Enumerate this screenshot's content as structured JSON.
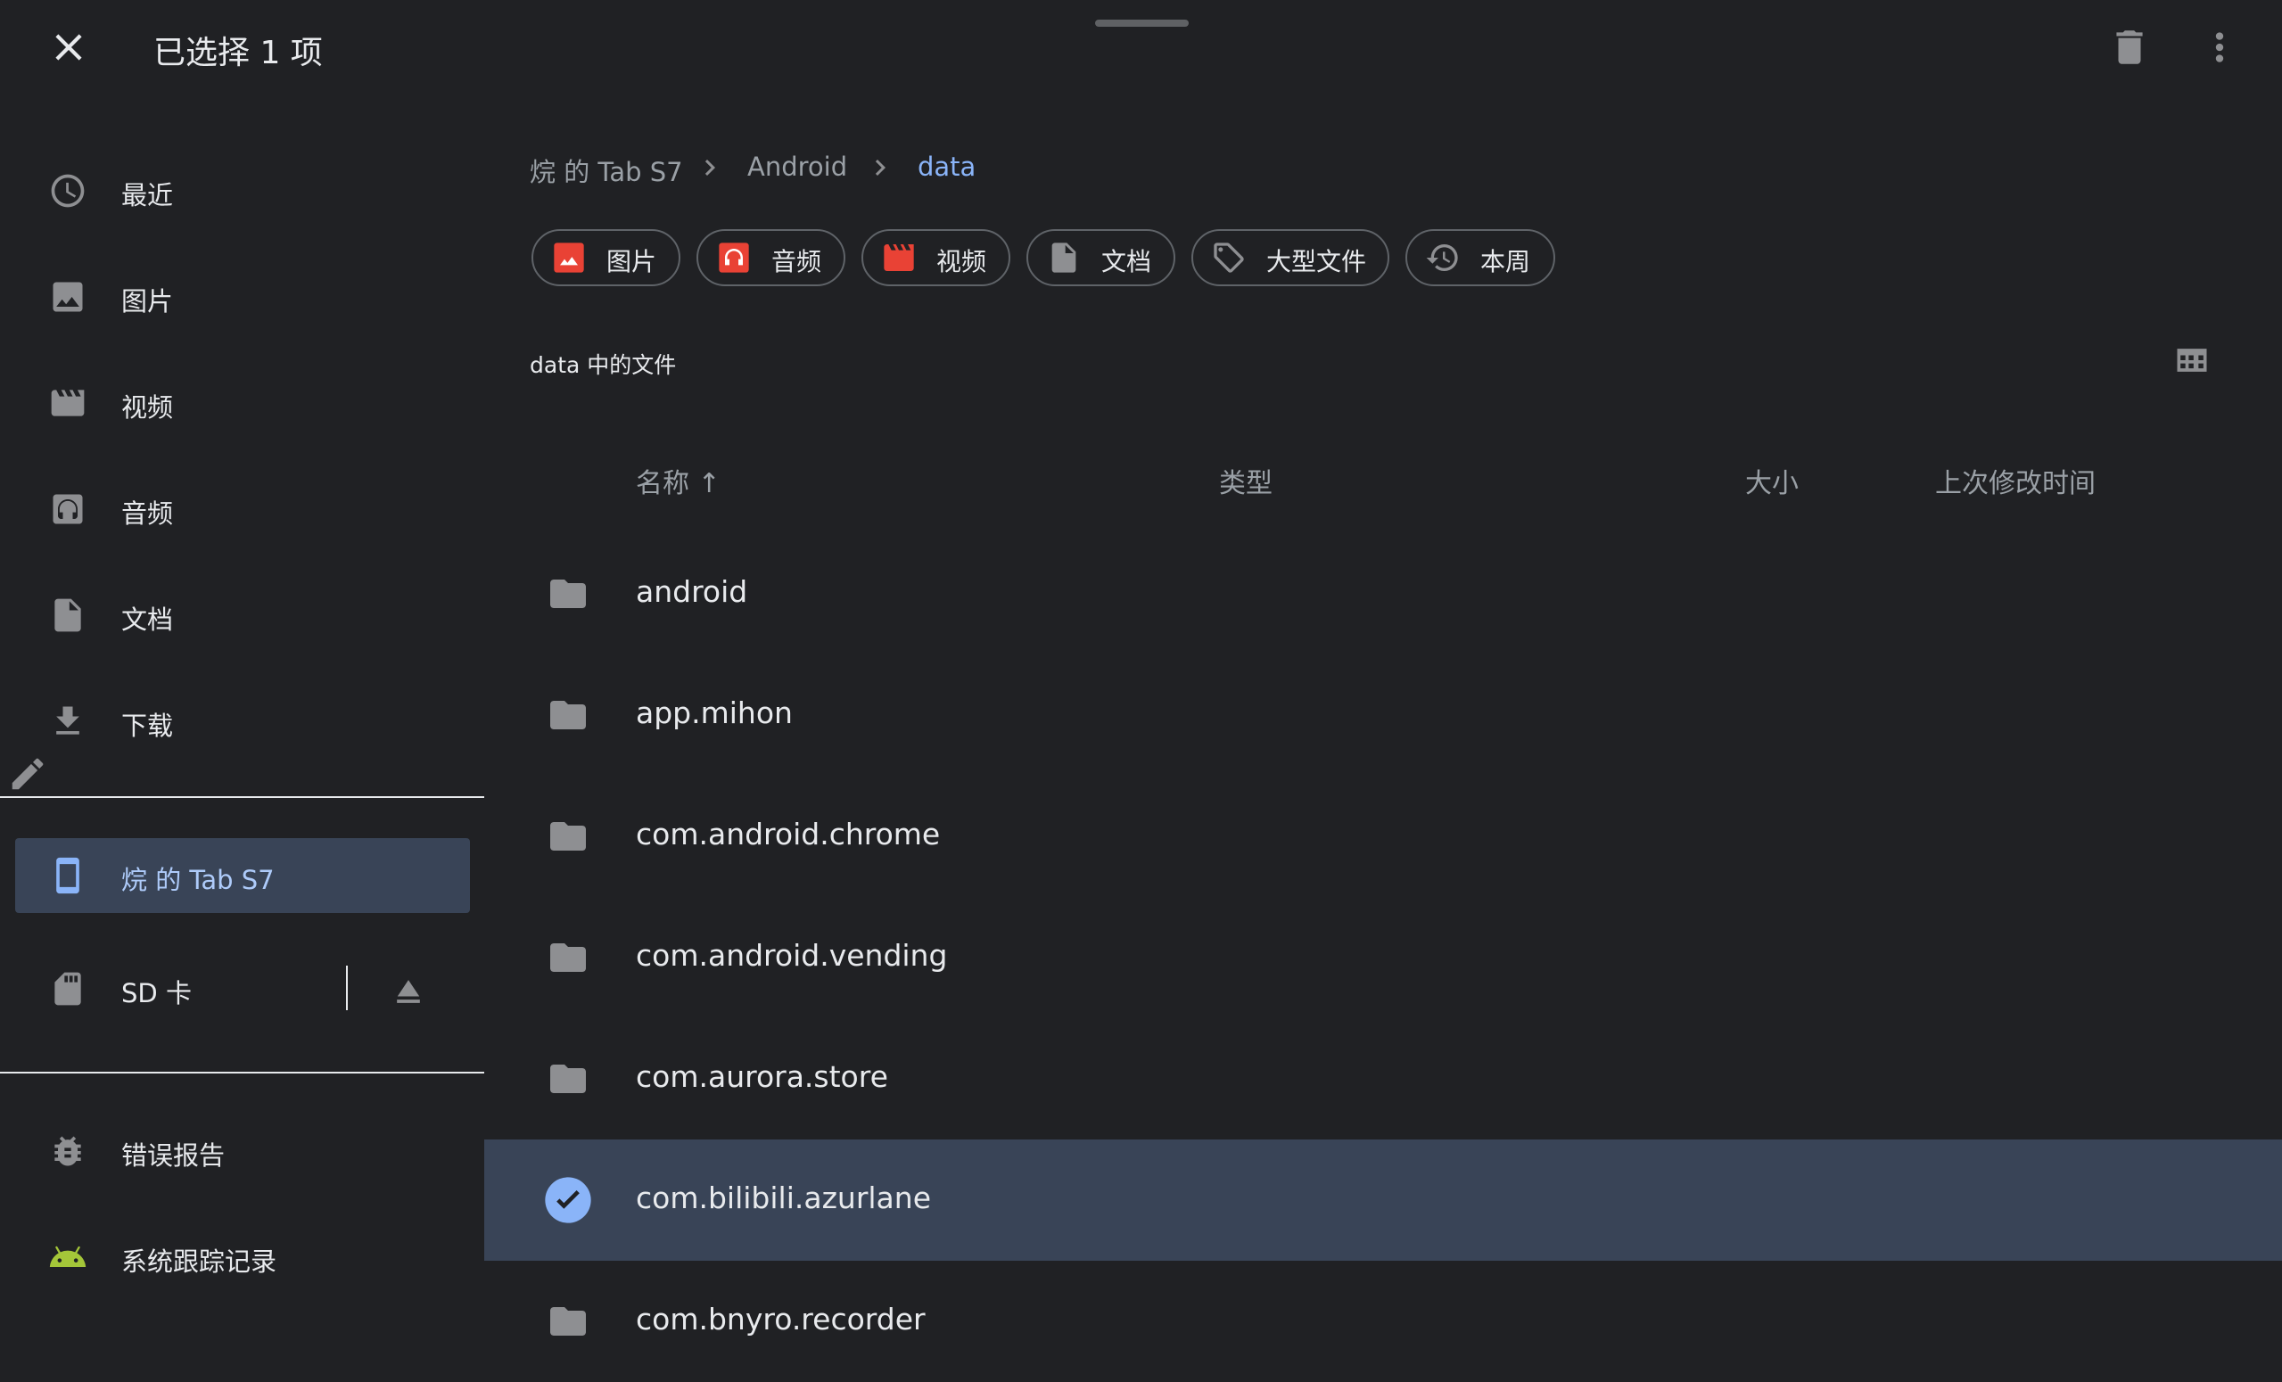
{
  "topbar": {
    "title": "已选择 1 项",
    "close_icon": "close-icon",
    "delete_icon": "delete-icon",
    "more_icon": "more-vert-icon"
  },
  "sidebar": {
    "items": [
      {
        "label": "最近",
        "icon": "clock-icon"
      },
      {
        "label": "图片",
        "icon": "image-icon"
      },
      {
        "label": "视频",
        "icon": "video-icon"
      },
      {
        "label": "音频",
        "icon": "audio-icon"
      },
      {
        "label": "文档",
        "icon": "document-icon"
      },
      {
        "label": "下载",
        "icon": "download-icon"
      }
    ],
    "device": {
      "label": "烷 的 Tab S7",
      "icon": "tablet-icon"
    },
    "sd": {
      "label": "SD 卡",
      "icon": "sd-card-icon",
      "eject_icon": "eject-icon"
    },
    "bottom": [
      {
        "label": "错误报告",
        "icon": "bug-icon"
      },
      {
        "label": "系统跟踪记录",
        "icon": "android-icon"
      }
    ]
  },
  "breadcrumb": [
    "烷 的 Tab S7",
    "Android",
    "data"
  ],
  "chips": [
    {
      "label": "图片",
      "icon": "image-icon"
    },
    {
      "label": "音频",
      "icon": "audio-icon"
    },
    {
      "label": "视频",
      "icon": "video-icon"
    },
    {
      "label": "文档",
      "icon": "document-icon"
    },
    {
      "label": "大型文件",
      "icon": "tag-icon"
    },
    {
      "label": "本周",
      "icon": "history-icon"
    }
  ],
  "section_label": "data 中的文件",
  "columns": {
    "name": "名称 ↑",
    "type": "类型",
    "size": "大小",
    "modified": "上次修改时间"
  },
  "files": [
    {
      "name": "android",
      "selected": false
    },
    {
      "name": "app.mihon",
      "selected": false
    },
    {
      "name": "com.android.chrome",
      "selected": false
    },
    {
      "name": "com.android.vending",
      "selected": false
    },
    {
      "name": "com.aurora.store",
      "selected": false
    },
    {
      "name": "com.bilibili.azurlane",
      "selected": true
    },
    {
      "name": "com.bnyro.recorder",
      "selected": false
    }
  ],
  "colors": {
    "background": "#202124",
    "selected": "#394457",
    "accent": "#8ab4f8",
    "chip_icon": "#e94235",
    "android": "#a4c639"
  }
}
